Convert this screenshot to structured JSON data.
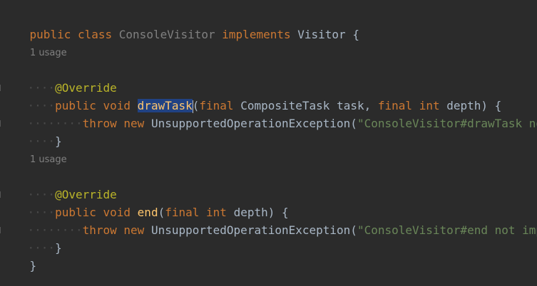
{
  "lines": {
    "l1": {
      "public": "public",
      "class": "class",
      "name": "ConsoleVisitor",
      "implements": "implements",
      "iface": "Visitor",
      "brace": "{"
    },
    "usage1": "1 usage",
    "l3": {
      "anno": "@Override"
    },
    "l4": {
      "public": "public",
      "void": "void",
      "method": "drawTask",
      "open": "(",
      "final1": "final",
      "type": "CompositeTask",
      "param1": "task,",
      "final2": "final",
      "int": "int",
      "param2": "depth)",
      "brace": "{"
    },
    "l5": {
      "throw": "throw",
      "new": "new",
      "exc": "UnsupportedOperationException(",
      "str": "\"ConsoleVisitor#drawTask no"
    },
    "l6": {
      "close": "}"
    },
    "usage2": "1 usage",
    "l8": {
      "anno": "@Override"
    },
    "l9": {
      "public": "public",
      "void": "void",
      "method": "end",
      "open": "(",
      "final1": "final",
      "int": "int",
      "param": "depth)",
      "brace": "{"
    },
    "l10": {
      "throw": "throw",
      "new": "new",
      "exc": "UnsupportedOperationException(",
      "str": "\"ConsoleVisitor#end not imp"
    },
    "l11": {
      "close": "}"
    },
    "l12": {
      "close": "}"
    }
  },
  "colors": {
    "background": "#2b2b2b",
    "keyword": "#cc7832",
    "method": "#ffc66d",
    "annotation": "#bbb529",
    "string": "#6a8759",
    "selection": "#214283"
  }
}
